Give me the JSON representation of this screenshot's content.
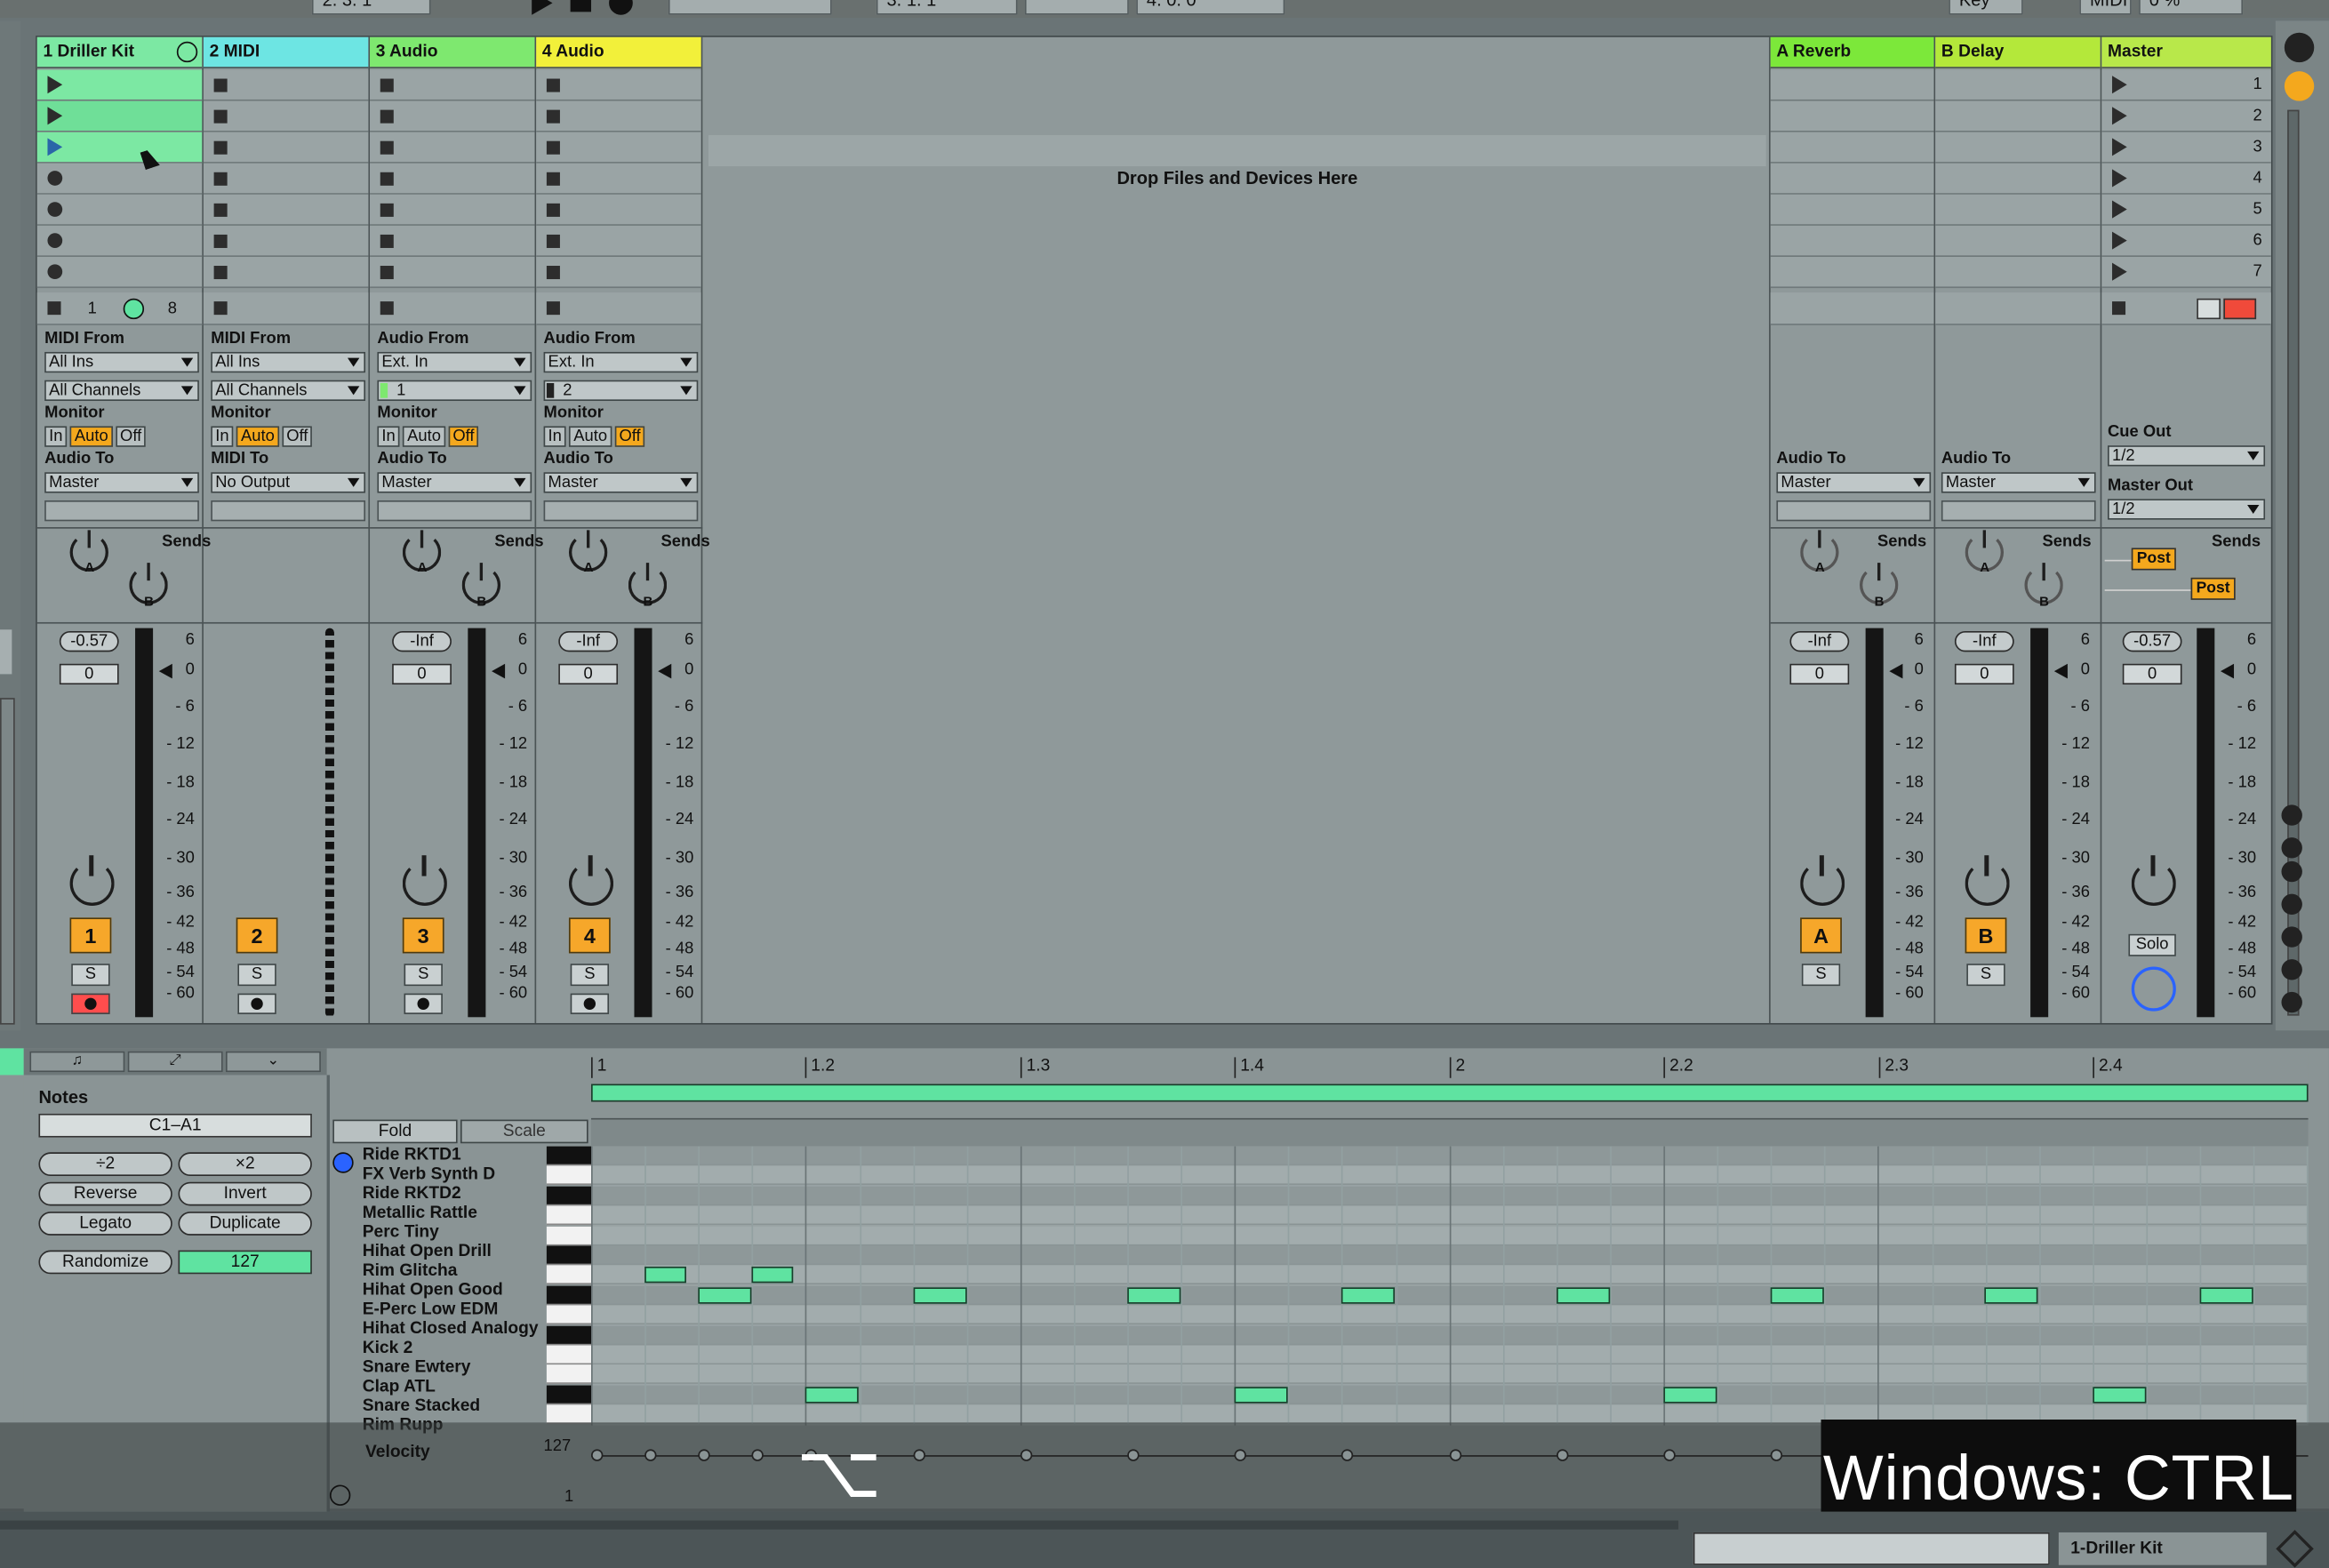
{
  "transport": {
    "position_a": "2. 3. 1",
    "position_b": "3. 1. 1",
    "position_c": "4. 0. 0",
    "key_label": "Key",
    "midi_label": "MIDI",
    "cpu": "0 %"
  },
  "tracks": [
    {
      "name": "1 Driller Kit",
      "color": "#7ce8a3",
      "input_label": "MIDI From",
      "input": "All Ins",
      "channel": "All Channels",
      "monitor_label": "Monitor",
      "monitor": [
        "In",
        "Auto",
        "Off"
      ],
      "monitor_active": "Auto",
      "out_label": "Audio To",
      "output": "Master",
      "sends_label": "Sends",
      "send_a": "A",
      "send_b": "B",
      "volume": "-0.57",
      "pan": "0",
      "number": "1",
      "solo": "S",
      "clip_count_a": "1",
      "clip_count_b": "8"
    },
    {
      "name": "2 MIDI",
      "color": "#6de5e3",
      "input_label": "MIDI From",
      "input": "All Ins",
      "channel": "All Channels",
      "monitor_label": "Monitor",
      "monitor": [
        "In",
        "Auto",
        "Off"
      ],
      "monitor_active": "Auto",
      "out_label": "MIDI To",
      "output": "No Output",
      "number": "2",
      "solo": "S"
    },
    {
      "name": "3 Audio",
      "color": "#7ee86f",
      "input_label": "Audio From",
      "input": "Ext. In",
      "channel": "1",
      "monitor_label": "Monitor",
      "monitor": [
        "In",
        "Auto",
        "Off"
      ],
      "monitor_active": "Off",
      "out_label": "Audio To",
      "output": "Master",
      "sends_label": "Sends",
      "send_a": "A",
      "send_b": "B",
      "volume": "-Inf",
      "pan": "0",
      "number": "3",
      "solo": "S"
    },
    {
      "name": "4 Audio",
      "color": "#f2f03a",
      "input_label": "Audio From",
      "input": "Ext. In",
      "channel": "2",
      "monitor_label": "Monitor",
      "monitor": [
        "In",
        "Auto",
        "Off"
      ],
      "monitor_active": "Off",
      "out_label": "Audio To",
      "output": "Master",
      "sends_label": "Sends",
      "send_a": "A",
      "send_b": "B",
      "volume": "-Inf",
      "pan": "0",
      "number": "4",
      "solo": "S"
    }
  ],
  "returns": [
    {
      "name": "A Reverb",
      "color": "#7ce83a",
      "out_label": "Audio To",
      "output": "Master",
      "sends_label": "Sends",
      "send_a": "A",
      "send_b": "B",
      "volume": "-Inf",
      "pan": "0",
      "number": "A",
      "solo": "S"
    },
    {
      "name": "B Delay",
      "color": "#b4e83a",
      "out_label": "Audio To",
      "output": "Master",
      "sends_label": "Sends",
      "send_a": "A",
      "send_b": "B",
      "volume": "-Inf",
      "pan": "0",
      "number": "B",
      "solo": "S"
    }
  ],
  "master": {
    "name": "Master",
    "color": "#b8e84a",
    "cue_label": "Cue Out",
    "cue": "1/2",
    "out_label": "Master Out",
    "output": "1/2",
    "sends_label": "Sends",
    "post_a": "Post",
    "post_b": "Post",
    "volume": "-0.57",
    "pan": "0",
    "solo": "Solo",
    "scenes": [
      "1",
      "2",
      "3",
      "4",
      "5",
      "6",
      "7"
    ]
  },
  "drop_text": "Drop Files and Devices Here",
  "meter_scale": [
    "6",
    "0",
    "6",
    "12",
    "18",
    "24",
    "30",
    "36",
    "42",
    "48",
    "54",
    "60"
  ],
  "clip": {
    "notes_label": "Notes",
    "range": "C1–A1",
    "half": "÷2",
    "double": "×2",
    "reverse": "Reverse",
    "invert": "Invert",
    "legato": "Legato",
    "duplicate": "Duplicate",
    "randomize": "Randomize",
    "randomize_value": "127",
    "fold": "Fold",
    "scale": "Scale",
    "velocity_label": "Velocity",
    "velocity_max": "127",
    "velocity_min": "1"
  },
  "ruler": [
    "1",
    "1.2",
    "1.3",
    "1.4",
    "2",
    "2.2",
    "2.3",
    "2.4"
  ],
  "drum_names": [
    "Ride RKTD1",
    "FX Verb Synth D",
    "Ride RKTD2",
    "Metallic Rattle",
    "Perc Tiny",
    "Hihat Open Drill",
    "Rim Glitcha",
    "Hihat Open Good",
    "E-Perc Low EDM",
    "Hihat Closed Analogy",
    "Kick 2",
    "Snare Ewtery",
    "Clap ATL",
    "Snare Stacked",
    "Rim Rupp"
  ],
  "caption": "Windows: CTRL",
  "option_key": "⌥",
  "status_clip": "1-Driller Kit",
  "colors": {
    "note": "#5fe3a1",
    "accent": "#f4a81d",
    "arm": "#ff4d4d"
  }
}
